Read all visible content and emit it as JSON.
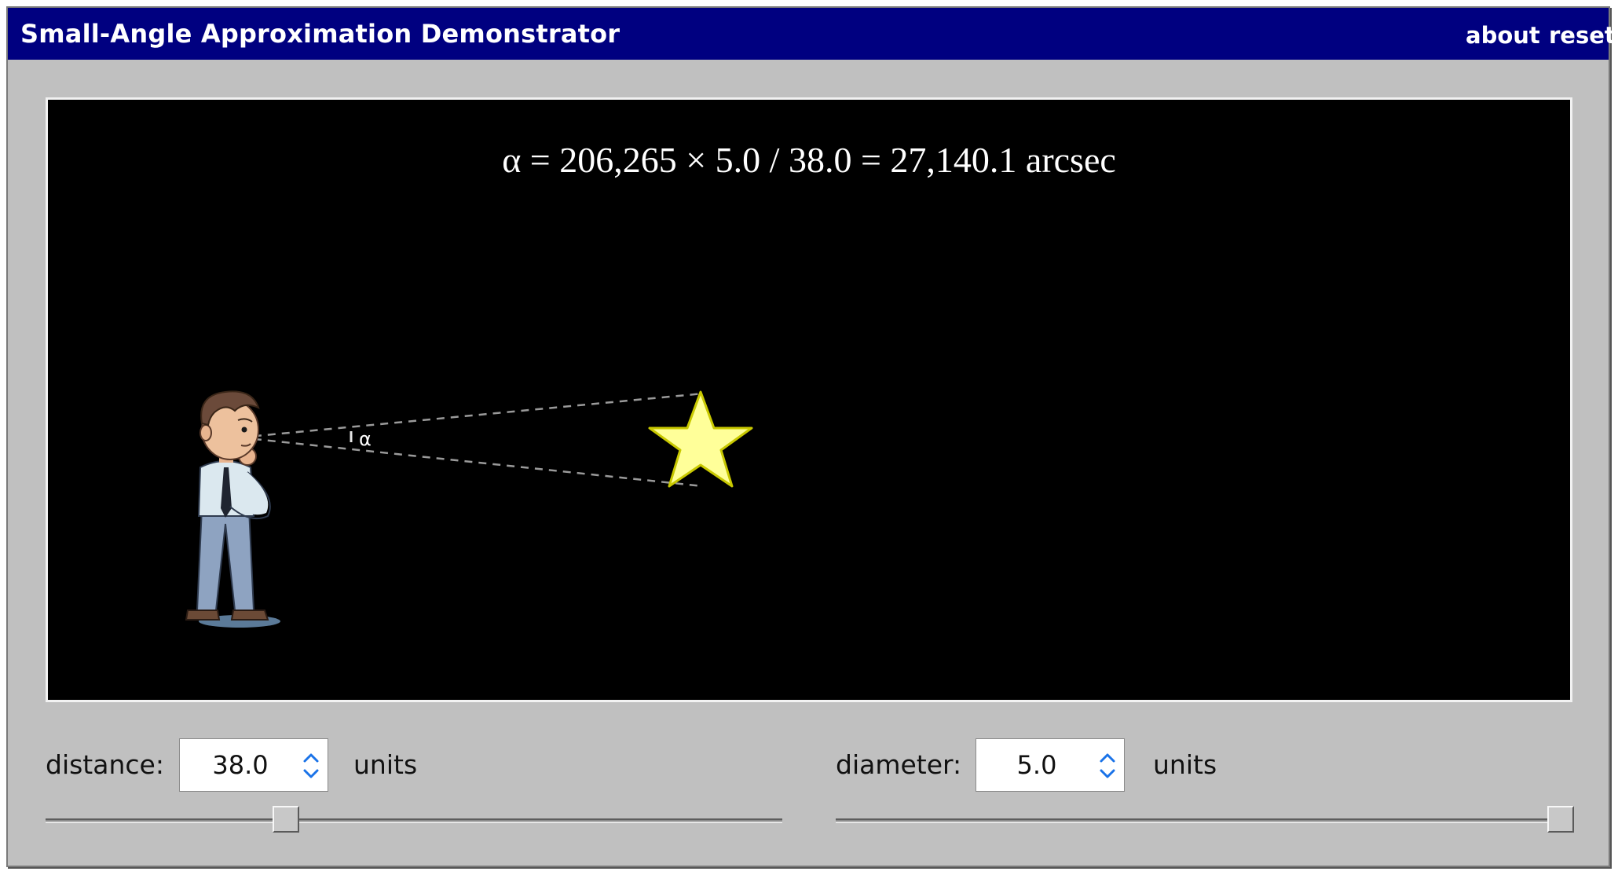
{
  "window": {
    "title": "Small-Angle Approximation Demonstrator",
    "menu": {
      "about": "about",
      "reset": "reset"
    }
  },
  "stage": {
    "formula": "α = 206,265 × 5.0 / 38.0 = 27,140.1 arcsec",
    "angle_label": "α"
  },
  "controls": {
    "distance": {
      "label": "distance:",
      "value": "38.0",
      "units": "units",
      "slider_fraction": 0.32
    },
    "diameter": {
      "label": "diameter:",
      "value": "5.0",
      "units": "units",
      "slider_fraction": 1.0
    }
  },
  "colors": {
    "titlebar": "#000080",
    "stage_background": "#000000",
    "star_fill": "#ffff99",
    "star_stroke": "#c8c800",
    "sight_lines": "#9a9a9a",
    "spinner_blue": "#1a73e8"
  }
}
